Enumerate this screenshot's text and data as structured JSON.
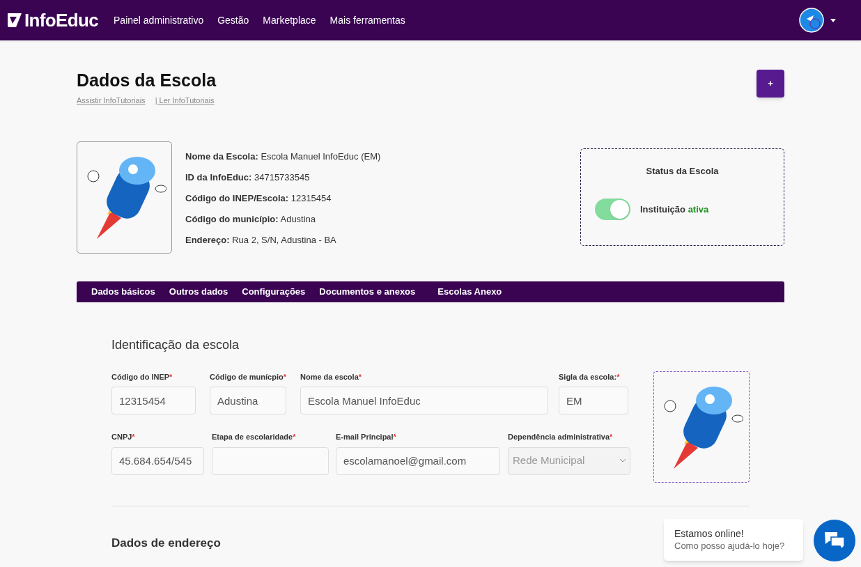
{
  "header": {
    "logo": "InfoEduc",
    "nav": [
      "Painel administrativo",
      "Gestão",
      "Marketplace",
      "Mais ferramentas"
    ]
  },
  "page": {
    "title": "Dados da Escola",
    "links": [
      "Assistir InfoTutoriais",
      "| Ler InfoTutoriais"
    ],
    "add_button": "+"
  },
  "school_info": [
    {
      "label": "Nome da Escola:",
      "value": "Escola Manuel InfoEduc (EM)"
    },
    {
      "label": "ID da InfoEduc:",
      "value": "34715733545"
    },
    {
      "label": "Código do INEP/Escola:",
      "value": "12315454"
    },
    {
      "label": "Código do município:",
      "value": "Adustina"
    },
    {
      "label": "Endereço:",
      "value": "Rua 2, S/N, Adustina - BA"
    }
  ],
  "status": {
    "title": "Status da Escola",
    "on": true,
    "label": "Instituição",
    "state_text": "ativa"
  },
  "tabs": [
    {
      "label": "Dados básicos",
      "selected": false
    },
    {
      "label": "Outros dados",
      "selected": false
    },
    {
      "label": "Configurações",
      "selected": false
    },
    {
      "label": "Documentos e anexos",
      "selected": false
    },
    {
      "label": "Escolas Anexo",
      "selected": false
    }
  ],
  "form": {
    "section_title": "Identificação da escola",
    "rows": [
      [
        {
          "kind": "input",
          "label": "Código do INEP",
          "required_mark": "*",
          "value": "12315454"
        },
        {
          "kind": "input",
          "label": "Código de munícpio",
          "required_mark": "*",
          "value": "Adustina"
        },
        {
          "kind": "input",
          "label": "Nome da escola",
          "required_mark": "*",
          "value": "Escola Manuel InfoEduc"
        },
        {
          "kind": "input",
          "label": "Sigla da escola:",
          "required_mark": "*",
          "value": "EM"
        }
      ],
      [
        {
          "kind": "input",
          "label": "CNPJ",
          "required_mark": "*",
          "value": "45.684.654/545"
        },
        {
          "kind": "input",
          "label": "Etapa de escolaridade",
          "required_mark": "*"
        },
        {
          "kind": "input",
          "label": "E-mail Principal",
          "required_mark": "*",
          "value": "escolamanoel@gmail.com"
        },
        {
          "kind": "select",
          "label": "Dependência administrativa",
          "required_mark": "*",
          "value": "Rede Municipal",
          "disabled": true
        }
      ]
    ],
    "next_section_title": "Dados de endereço"
  },
  "chat": {
    "title": "Estamos online!",
    "subtitle": "Como posso ajudá-lo hoje?"
  }
}
